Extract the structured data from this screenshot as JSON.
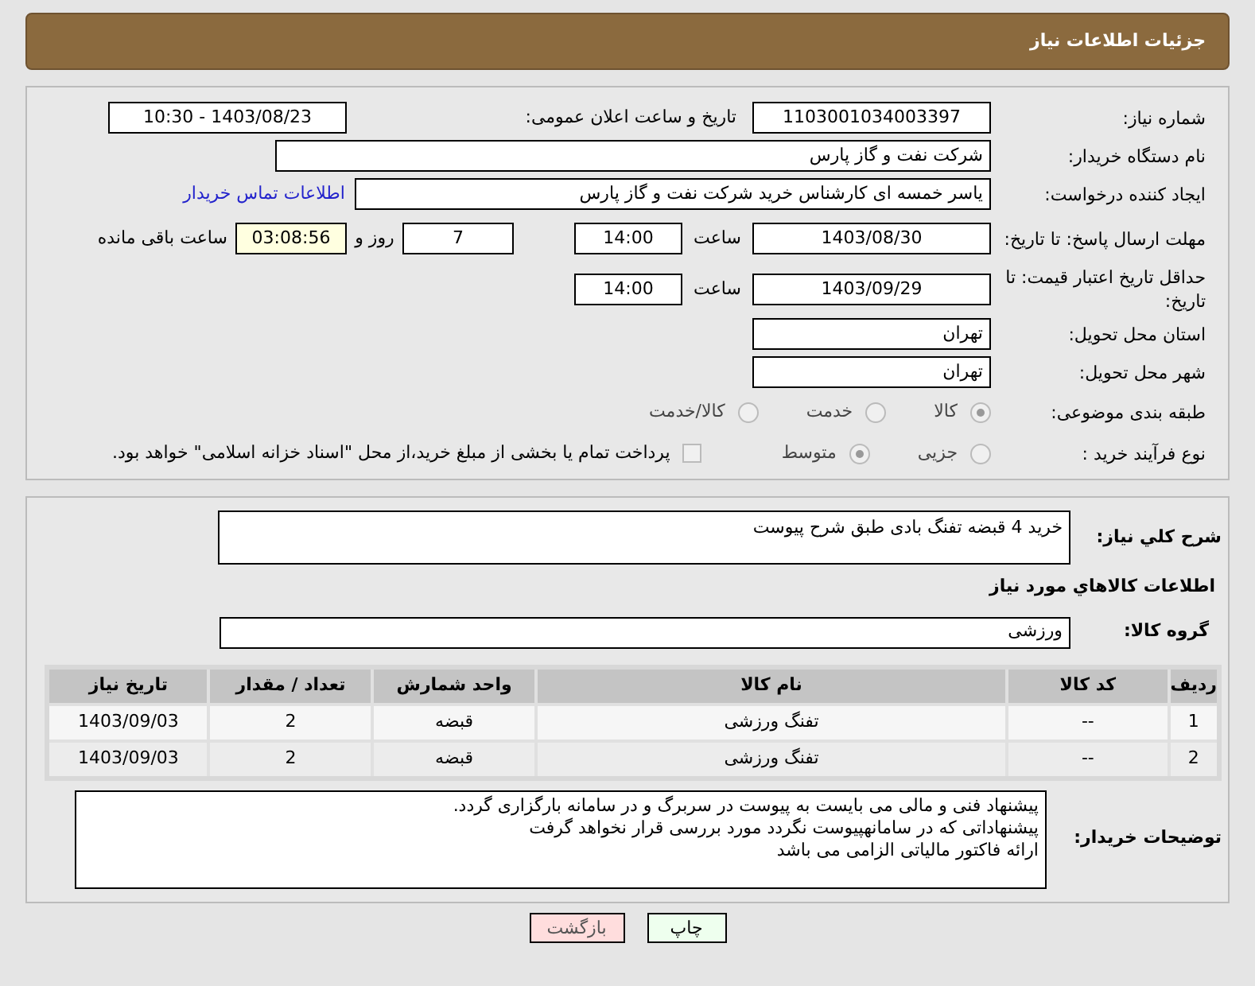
{
  "header": {
    "title": "جزئیات اطلاعات نیاز"
  },
  "need_number": {
    "label": "شماره نیاز:",
    "value": "1103001034003397"
  },
  "announce": {
    "label": "تاریخ و ساعت اعلان عمومی:",
    "value": "1403/08/23 - 10:30"
  },
  "buyer": {
    "label": "نام دستگاه خریدار:",
    "value": "شرکت نفت و گاز پارس"
  },
  "creator": {
    "label": "ایجاد کننده درخواست:",
    "value": "یاسر  خمسه ای کارشناس خرید  شرکت نفت و گاز پارس",
    "link": "اطلاعات تماس خریدار"
  },
  "deadline": {
    "label": "مهلت ارسال پاسخ: تا تاریخ:",
    "date": "1403/08/30",
    "time_label": "ساعت",
    "time": "14:00",
    "days": "7",
    "days_label": "روز و",
    "remaining": "03:08:56",
    "remaining_label": "ساعت باقی مانده"
  },
  "validity": {
    "label": "حداقل تاریخ اعتبار قیمت: تا تاریخ:",
    "date": "1403/09/29",
    "time_label": "ساعت",
    "time": "14:00"
  },
  "province": {
    "label": "استان محل تحویل:",
    "value": "تهران"
  },
  "city": {
    "label": "شهر محل تحویل:",
    "value": "تهران"
  },
  "category": {
    "label": "طبقه بندی موضوعی:",
    "options": [
      {
        "label": "کالا",
        "selected": true
      },
      {
        "label": "خدمت",
        "selected": false
      },
      {
        "label": "کالا/خدمت",
        "selected": false
      }
    ]
  },
  "process": {
    "label": "نوع فرآیند خرید :",
    "options": [
      {
        "label": "جزیی",
        "selected": false
      },
      {
        "label": "متوسط",
        "selected": true
      }
    ],
    "treasury": {
      "label": "پرداخت تمام یا بخشی از مبلغ خرید،از محل \"اسناد خزانه اسلامی\" خواهد بود.",
      "checked": false
    }
  },
  "description": {
    "label": "شرح کلي نياز:",
    "value": "خرید 4 قبضه تفنگ بادی طبق شرح پیوست"
  },
  "goods_title": "اطلاعات کالاهاي مورد نياز",
  "goods_group": {
    "label": "گروه کالا:",
    "value": "ورزشی"
  },
  "table": {
    "columns": [
      "ردیف",
      "کد کالا",
      "نام کالا",
      "واحد شمارش",
      "تعداد / مقدار",
      "تاریخ نیاز"
    ],
    "rows": [
      [
        "1",
        "--",
        "تفنگ ورزشی",
        "قبضه",
        "2",
        "1403/09/03"
      ],
      [
        "2",
        "--",
        "تفنگ ورزشی",
        "قبضه",
        "2",
        "1403/09/03"
      ]
    ]
  },
  "notes": {
    "label": "توضیحات خریدار:",
    "value": "پیشنهاد فنی و مالی می بایست به پیوست در سربرگ و در سامانه بارگزاری گردد.\nپیشنهاداتی که در سامانهپیوست نگردد مورد بررسی قرار نخواهد گرفت\nارائه فاکتور مالیاتی الزامی می باشد"
  },
  "buttons": [
    {
      "label": "چاپ",
      "kind": "print"
    },
    {
      "label": "بازگشت",
      "kind": "back"
    }
  ]
}
